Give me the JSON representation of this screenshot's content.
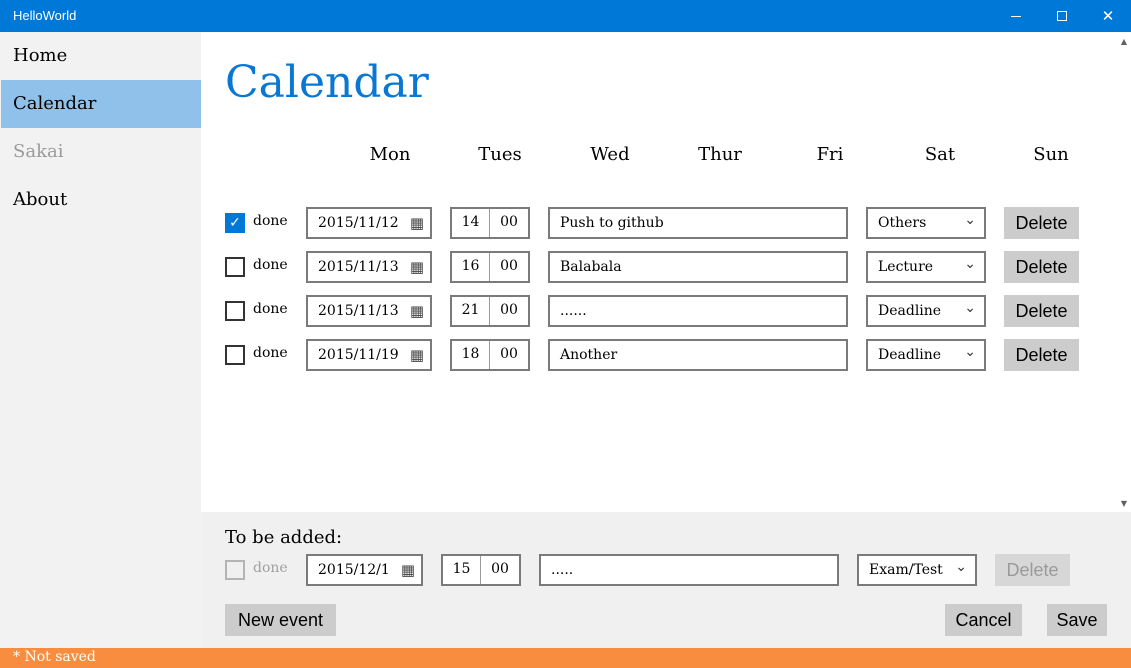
{
  "window": {
    "title": "HelloWorld",
    "minimize_label": "",
    "maximize_label": "",
    "close_label": "✕"
  },
  "sidebar": {
    "items": [
      {
        "label": "Home",
        "state": "normal"
      },
      {
        "label": "Calendar",
        "state": "active"
      },
      {
        "label": "Sakai",
        "state": "disabled"
      },
      {
        "label": "About",
        "state": "normal"
      }
    ]
  },
  "main": {
    "title": "Calendar",
    "days": [
      "Mon",
      "Tues",
      "Wed",
      "Thur",
      "Fri",
      "Sat",
      "Sun"
    ],
    "events": [
      {
        "done": true,
        "done_label": "done",
        "date": "2015/11/12",
        "hour": "14",
        "minute": "00",
        "text": "Push to github",
        "category": "Others",
        "delete_label": "Delete"
      },
      {
        "done": false,
        "done_label": "done",
        "date": "2015/11/13",
        "hour": "16",
        "minute": "00",
        "text": "Balabala",
        "category": "Lecture",
        "delete_label": "Delete"
      },
      {
        "done": false,
        "done_label": "done",
        "date": "2015/11/13",
        "hour": "21",
        "minute": "00",
        "text": "......",
        "category": "Deadline",
        "delete_label": "Delete"
      },
      {
        "done": false,
        "done_label": "done",
        "date": "2015/11/19",
        "hour": "18",
        "minute": "00",
        "text": "Another",
        "category": "Deadline",
        "delete_label": "Delete"
      }
    ]
  },
  "new_event": {
    "heading": "To be added:",
    "done_label": "done",
    "date": "2015/12/1",
    "hour": "15",
    "minute": "00",
    "text": ".....",
    "category": "Exam/Test",
    "delete_label": "Delete",
    "new_event_label": "New event",
    "cancel_label": "Cancel",
    "save_label": "Save"
  },
  "status": {
    "text": "* Not saved"
  },
  "icons": {
    "calendar": "calendar-icon",
    "chevron": "chevron-down-icon",
    "check": "checkmark-icon"
  },
  "colors": {
    "titlebar": "#0078d7",
    "accent": "#0a78d2",
    "active_nav": "#90c1eb",
    "status_bar": "#f88d3f"
  }
}
